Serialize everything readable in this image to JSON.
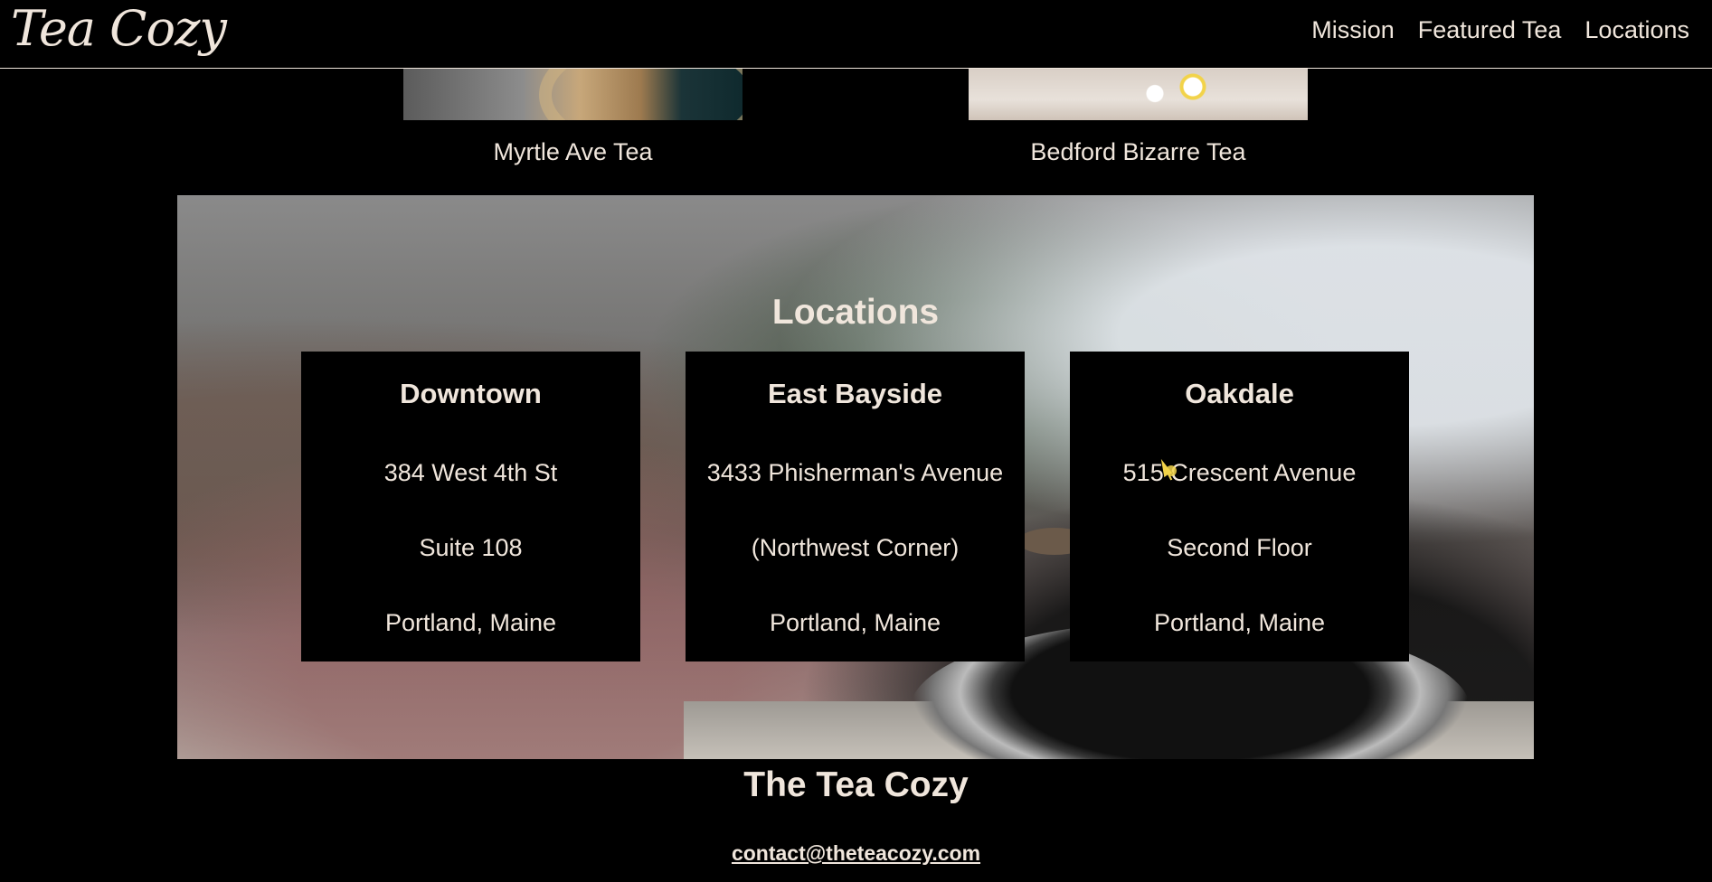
{
  "header": {
    "logo": "Tea Cozy",
    "nav": [
      "Mission",
      "Featured Tea",
      "Locations"
    ]
  },
  "featured_tea": {
    "items": [
      {
        "name": "Myrtle Ave Tea"
      },
      {
        "name": "Bedford Bizarre Tea"
      }
    ]
  },
  "locations": {
    "title": "Locations",
    "cards": [
      {
        "name": "Downtown",
        "lines": [
          "384 West 4th St",
          "Suite 108",
          "Portland, Maine"
        ]
      },
      {
        "name": "East Bayside",
        "lines": [
          "3433 Phisherman's Avenue",
          "(Northwest Corner)",
          "Portland, Maine"
        ]
      },
      {
        "name": "Oakdale",
        "lines": [
          "515 Crescent Avenue",
          "Second Floor",
          "Portland, Maine"
        ]
      }
    ]
  },
  "footer": {
    "title": "The Tea Cozy",
    "email": "contact@theteacozy.com"
  },
  "colors": {
    "background": "#000000",
    "text": "#f0e6dc",
    "cursor": "#f2d34a"
  },
  "icons": {
    "cursor": "mouse-pointer-icon"
  }
}
